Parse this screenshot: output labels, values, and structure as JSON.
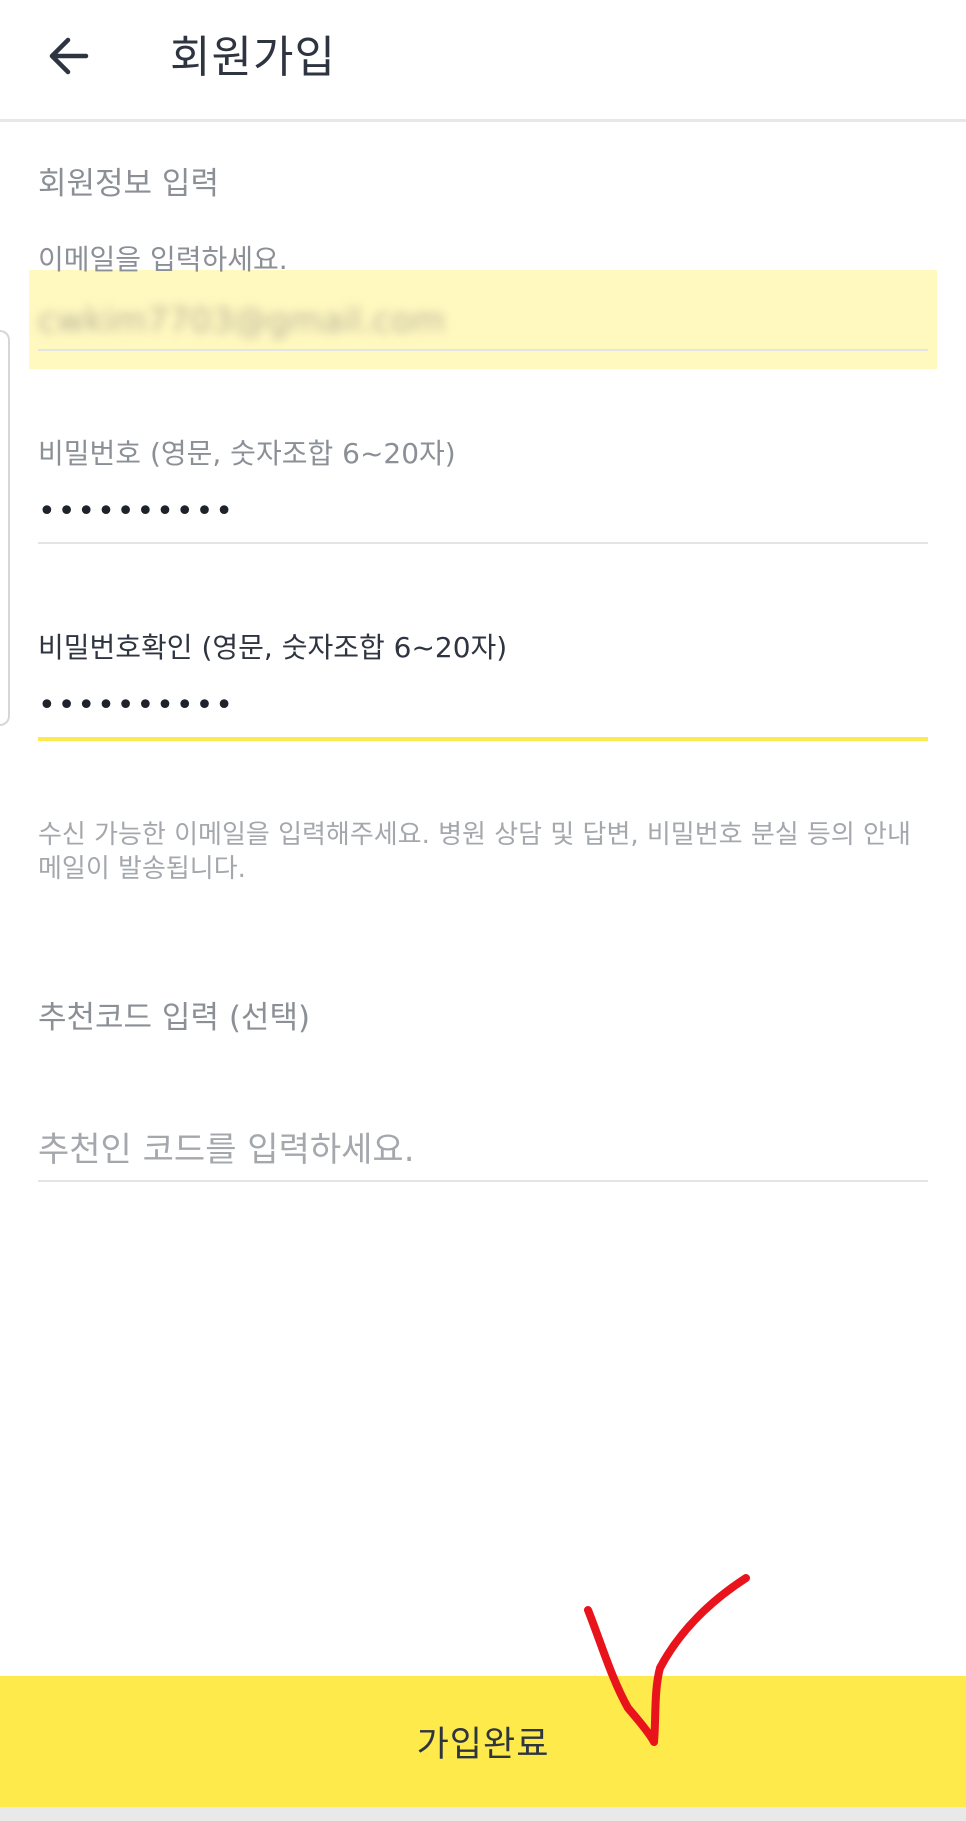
{
  "header": {
    "back_icon": "arrow-left-icon",
    "title": "회원가입"
  },
  "form": {
    "section_title": "회원정보 입력",
    "email": {
      "label": "이메일을 입력하세요.",
      "value": "cwkim7703@gmail.com"
    },
    "password": {
      "label": "비밀번호 (영문, 숫자조합 6~20자)",
      "value": "••••••••••"
    },
    "password_confirm": {
      "label": "비밀번호확인 (영문, 숫자조합 6~20자)",
      "value": "••••••••••"
    },
    "help_text": "수신 가능한 이메일을 입력해주세요. 병원 상담 및 답변, 비밀번호 분실 등의 안내 메일이 발송됩니다."
  },
  "referral": {
    "title": "추천코드 입력 (선택)",
    "placeholder": "추천인 코드를 입력하세요."
  },
  "submit": {
    "label": "가입완료"
  },
  "colors": {
    "accent": "#feea4b",
    "active_underline": "#fcea4f",
    "annotation": "#e8131b"
  }
}
